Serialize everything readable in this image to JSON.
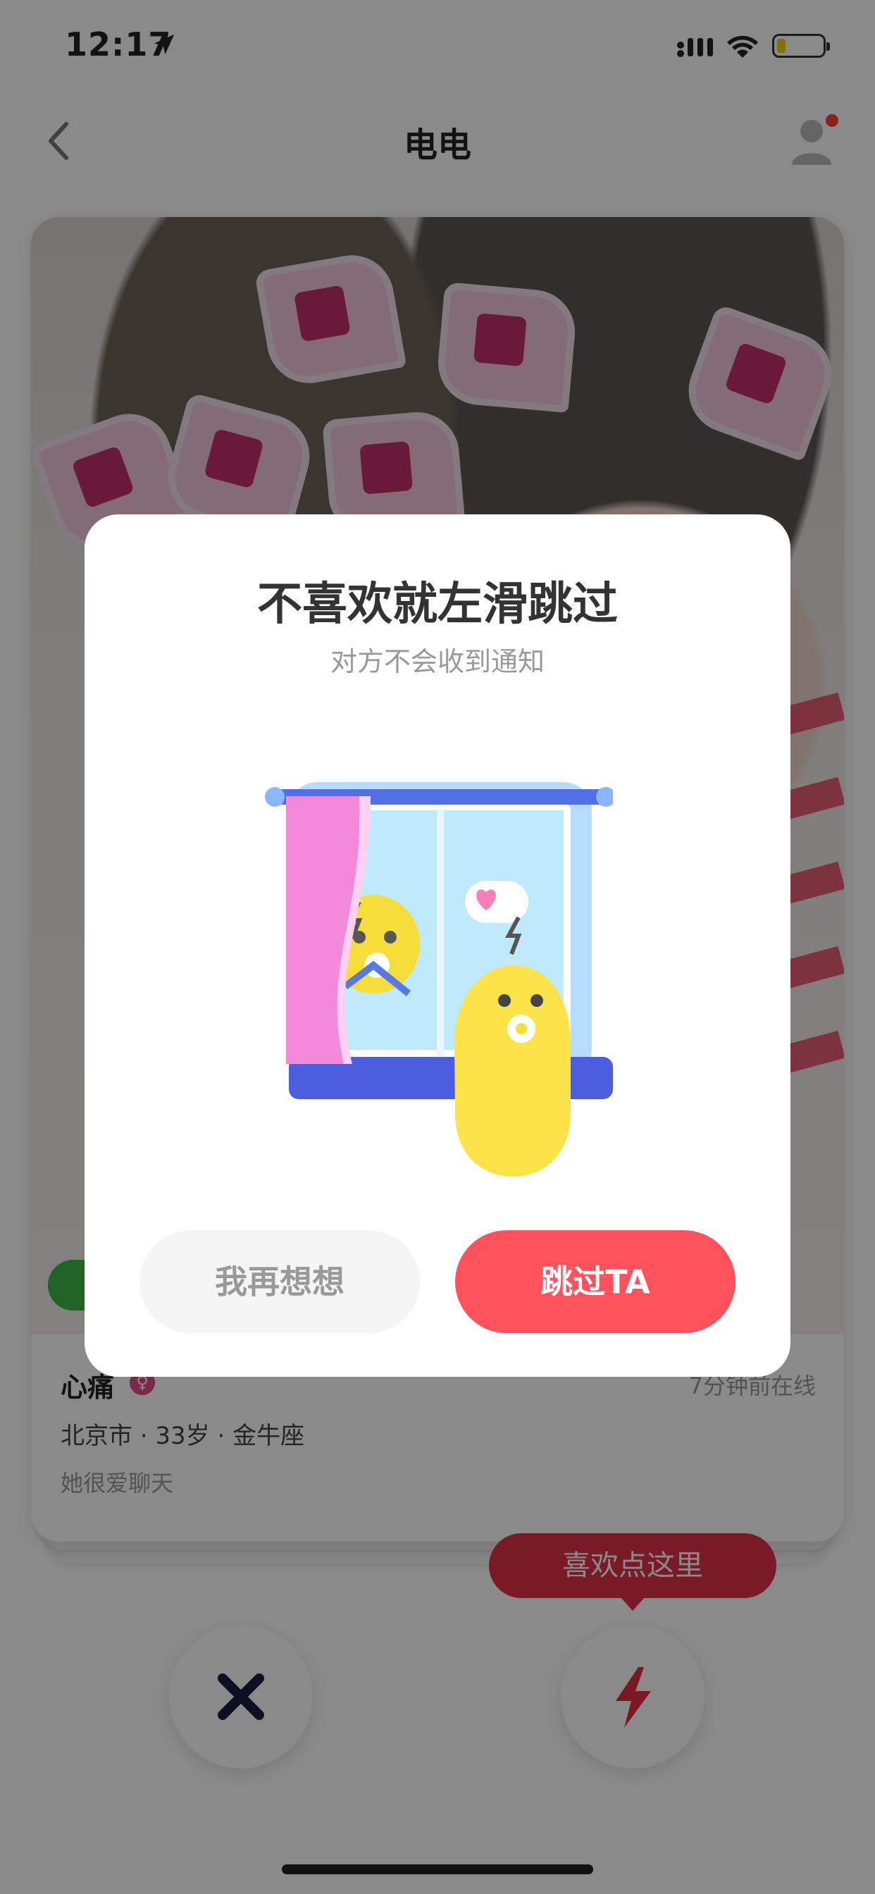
{
  "status_bar": {
    "time": "12:17"
  },
  "nav": {
    "title": "电电"
  },
  "profile": {
    "name": "心痛",
    "last_online": "7分钟前在线",
    "meta": "北京市 · 33岁 · 金牛座",
    "bio": "她很爱聊天"
  },
  "actions": {
    "like_tooltip": "喜欢点这里"
  },
  "modal": {
    "title": "不喜欢就左滑跳过",
    "subtitle": "对方不会收到通知",
    "cancel_label": "我再想想",
    "skip_label": "跳过TA"
  },
  "colors": {
    "accent_red": "#ff525c",
    "tooltip_red": "#e23048",
    "overlay": "rgba(0,0,0,0.46)"
  },
  "icons": [
    "location-arrow-icon",
    "signal-icon",
    "wifi-icon",
    "battery-icon",
    "back-chevron-icon",
    "user-icon",
    "chat-badge-icon",
    "gender-icon",
    "close-x-icon",
    "lightning-icon",
    "window-illustration"
  ]
}
